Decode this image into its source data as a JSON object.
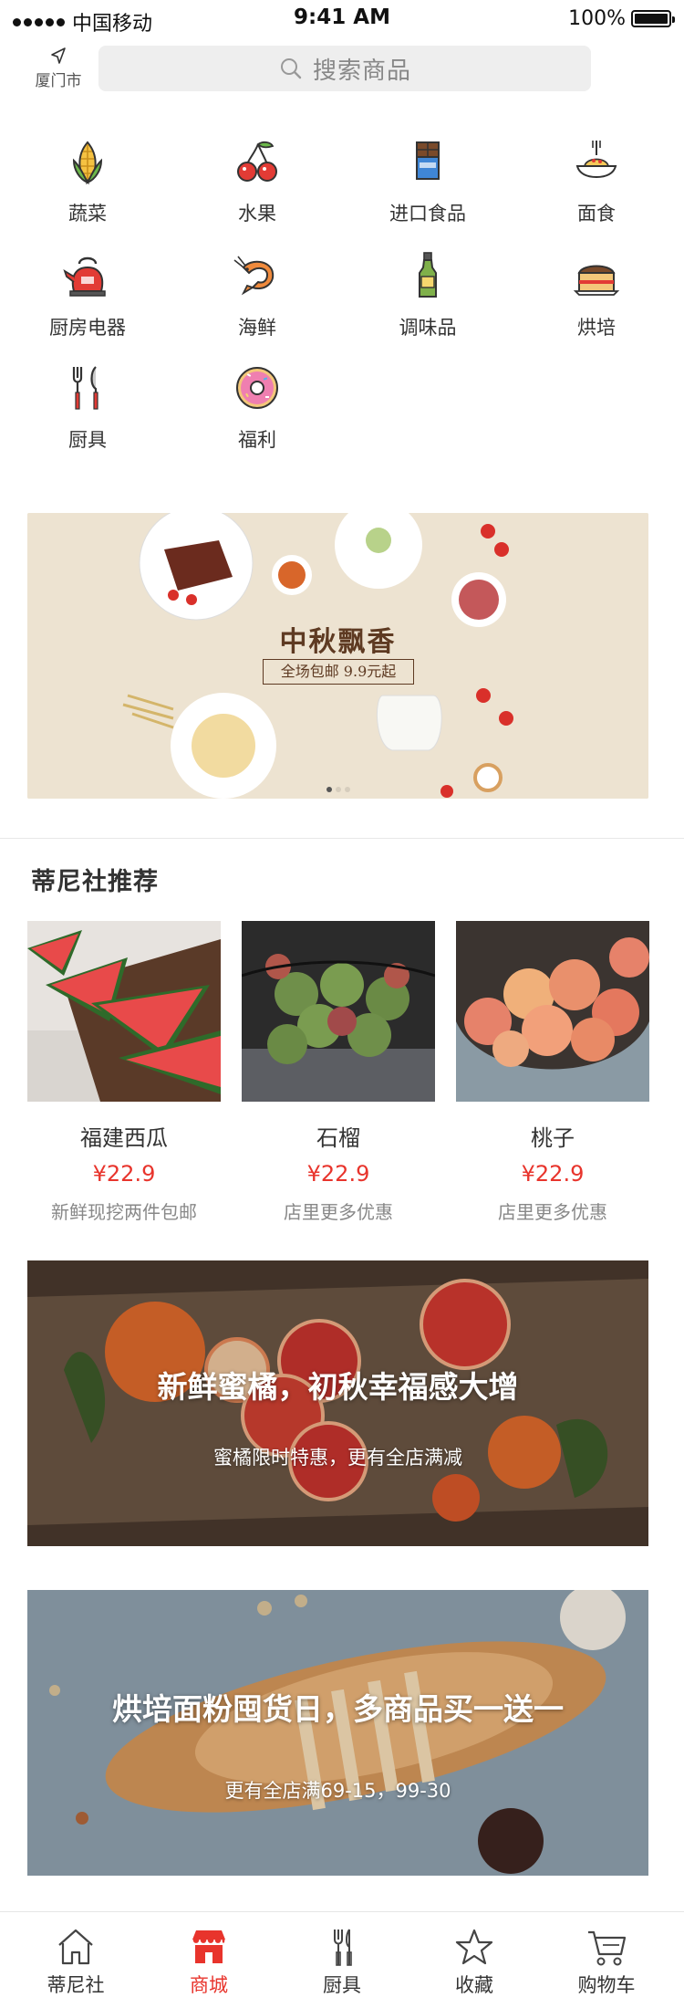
{
  "status_bar": {
    "carrier": "中国移动",
    "time": "9:41 AM",
    "battery": "100%"
  },
  "header": {
    "location": "厦门市",
    "search_placeholder": "搜索商品"
  },
  "categories": [
    {
      "label": "蔬菜",
      "icon": "corn-icon"
    },
    {
      "label": "水果",
      "icon": "cherry-icon"
    },
    {
      "label": "进口食品",
      "icon": "chocolate-icon"
    },
    {
      "label": "面食",
      "icon": "noodles-icon"
    },
    {
      "label": "厨房电器",
      "icon": "kettle-icon"
    },
    {
      "label": "海鲜",
      "icon": "shrimp-icon"
    },
    {
      "label": "调味品",
      "icon": "sauce-bottle-icon"
    },
    {
      "label": "烘培",
      "icon": "cake-icon"
    },
    {
      "label": "厨具",
      "icon": "utensils-icon"
    },
    {
      "label": "福利",
      "icon": "donut-icon"
    }
  ],
  "banner": {
    "title": "中秋飘香",
    "subtitle": "全场包邮 9.9元起",
    "slides": 3,
    "active_slide": 1
  },
  "recommend": {
    "title": "蒂尼社推荐",
    "products": [
      {
        "name": "福建西瓜",
        "price": "¥22.9",
        "note": "新鲜现挖两件包邮",
        "image": "watermelon-image"
      },
      {
        "name": "石榴",
        "price": "¥22.9",
        "note": "店里更多优惠",
        "image": "fig-image"
      },
      {
        "name": "桃子",
        "price": "¥22.9",
        "note": "店里更多优惠",
        "image": "peach-image"
      }
    ]
  },
  "promos": [
    {
      "title": "新鲜蜜橘，初秋幸福感大增",
      "subtitle": "蜜橘限时特惠，更有全店满减",
      "image": "blood-orange-image"
    },
    {
      "title": "烘培面粉囤货日，多商品买一送一",
      "subtitle": "更有全店满69-15，99-30",
      "image": "bread-image"
    }
  ],
  "tabbar": {
    "active": "商城",
    "tabs": [
      {
        "label": "蒂尼社",
        "icon": "home-icon"
      },
      {
        "label": "商城",
        "icon": "store-icon"
      },
      {
        "label": "厨具",
        "icon": "utensils-icon"
      },
      {
        "label": "收藏",
        "icon": "star-icon"
      },
      {
        "label": "购物车",
        "icon": "cart-icon"
      }
    ]
  },
  "colors": {
    "accent": "#e8342c",
    "search_bg": "#eeeeee",
    "banner_text": "#5e3a22"
  }
}
